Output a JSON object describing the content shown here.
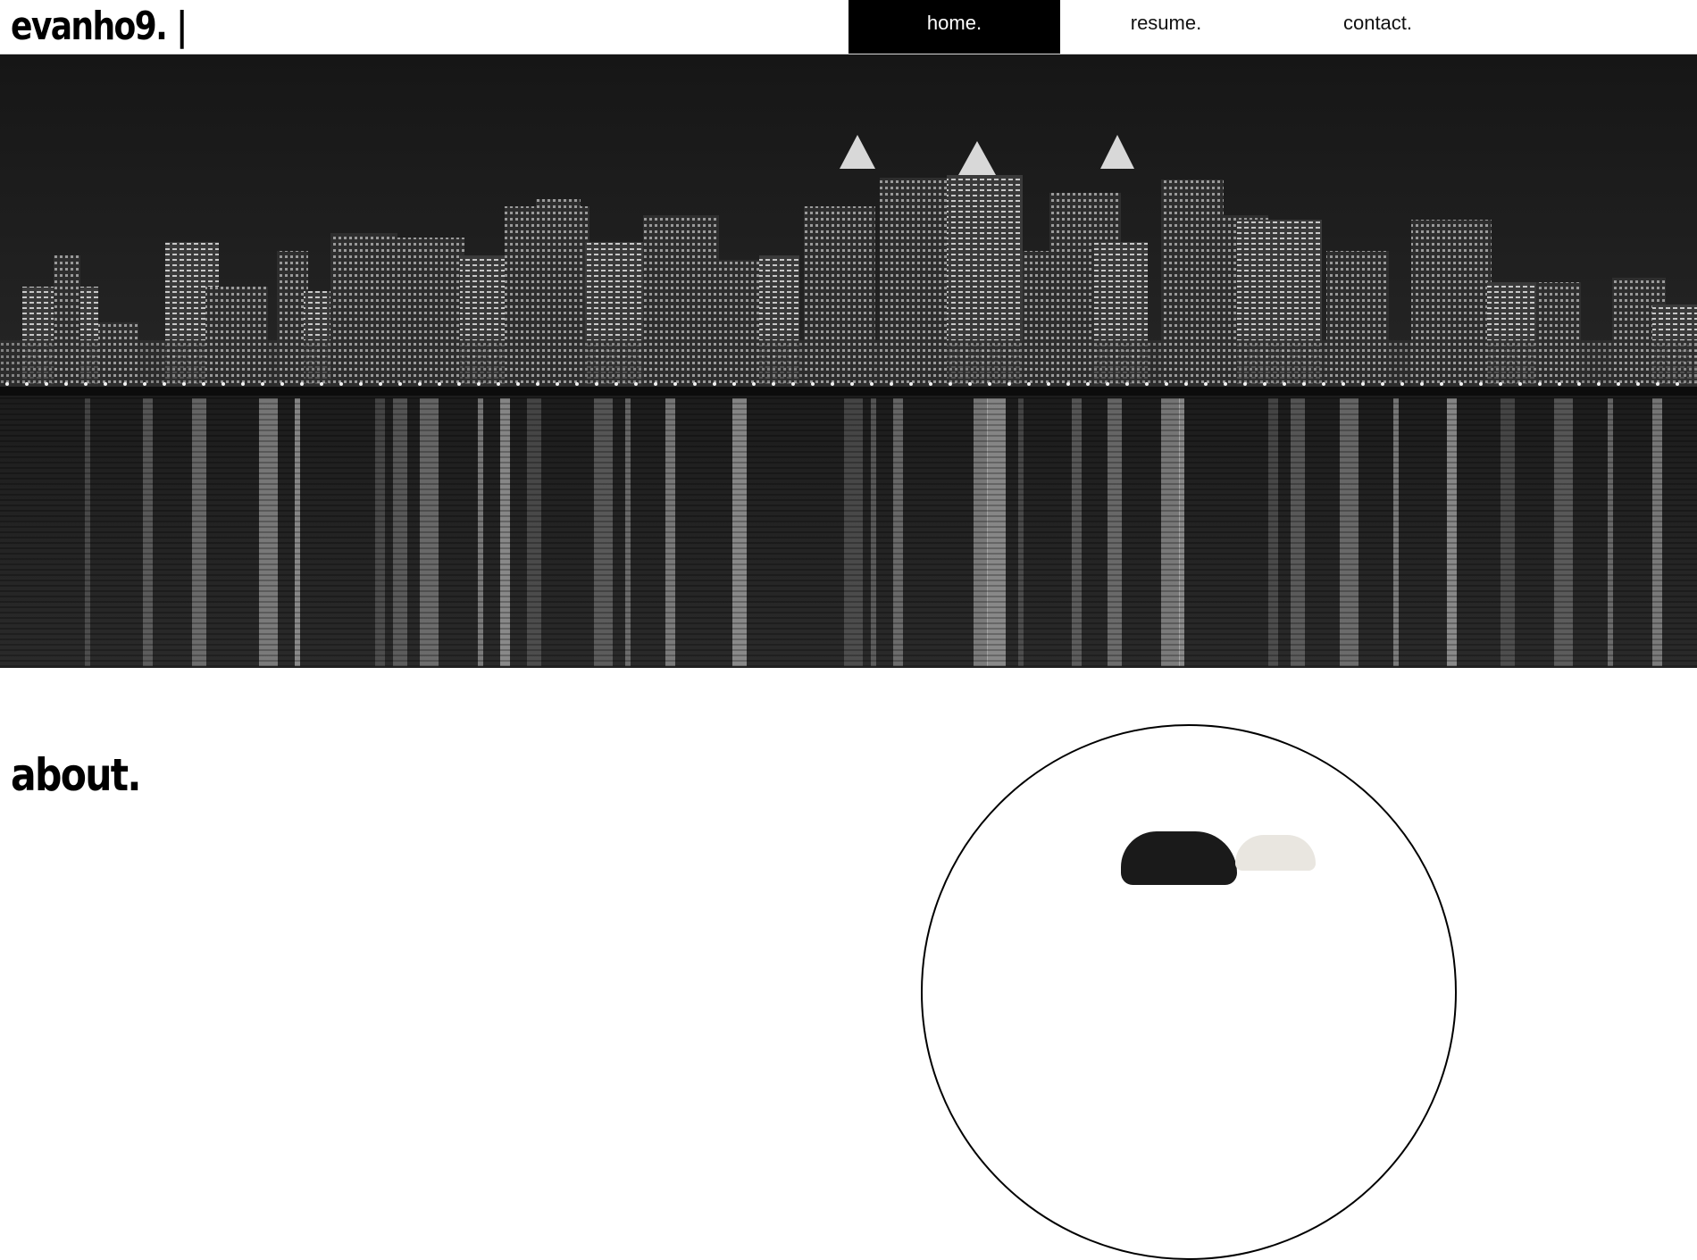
{
  "header": {
    "logo": "evanho9. |",
    "nav": [
      {
        "label": "home.",
        "active": true
      },
      {
        "label": "resume.",
        "active": false
      },
      {
        "label": "contact.",
        "active": false
      }
    ]
  },
  "hero": {
    "image": "city-skyline-night-photo"
  },
  "about": {
    "title": "about."
  },
  "profile": {
    "image": "profile-photo"
  },
  "colors": {
    "accent": "#000000",
    "background": "#ffffff"
  }
}
